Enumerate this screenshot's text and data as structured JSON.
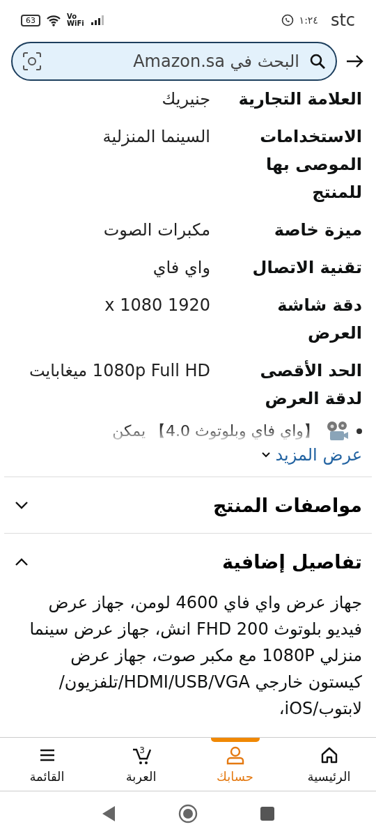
{
  "status_bar": {
    "carrier": "stc",
    "time": "١:٢٤",
    "battery": "63",
    "wifi_label": "Vo WiFi"
  },
  "search": {
    "placeholder": "البحث في Amazon.sa"
  },
  "specs": [
    {
      "label": "العلامة التجارية",
      "value": "جنيريك"
    },
    {
      "label": "الاستخدامات الموصى بها للمنتج",
      "value": "السينما المنزلية"
    },
    {
      "label": "ميزة خاصة",
      "value": "مكبرات الصوت"
    },
    {
      "label": "تقنية الاتصال",
      "value": "واي فاي"
    },
    {
      "label": "دقة شاشة العرض",
      "value": "1920 x 1080"
    },
    {
      "label": "الحد الأقصى لدقة العرض",
      "value": "1080p Full HD ميغابايت"
    }
  ],
  "bullet": "【واي فاي وبلوتوث 4.0】 يمكن",
  "show_more": "عرض المزيد",
  "sections": [
    {
      "title": "مواصفات المنتج",
      "expanded": false
    },
    {
      "title": "تفاصيل إضافية",
      "expanded": true,
      "text": "جهاز عرض واي فاي 4600 لومن، جهاز عرض فيديو بلوتوث FHD 200 انش، جهاز عرض سينما منزلي 1080P مع مكبر صوت، جهاز عرض كيستون خارجي HDMI/USB/VGA/تلفزيون/لابتوب/iOS،"
    }
  ],
  "bottom_nav": [
    {
      "kind": "home",
      "label": "الرئيسية",
      "selected": false
    },
    {
      "kind": "account",
      "label": "حسابك",
      "selected": true
    },
    {
      "kind": "cart",
      "label": "العربة",
      "selected": false,
      "badge": "3"
    },
    {
      "kind": "menu",
      "label": "القائمة",
      "selected": false
    }
  ]
}
